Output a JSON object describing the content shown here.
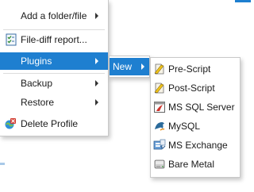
{
  "main_menu": {
    "items": [
      {
        "label": "Add a folder/file",
        "submenu": true
      },
      {
        "label": "File-diff report...",
        "submenu": false
      },
      {
        "label": "Plugins",
        "submenu": true
      },
      {
        "label": "Backup",
        "submenu": true
      },
      {
        "label": "Restore",
        "submenu": true
      },
      {
        "label": "Delete Profile",
        "submenu": false
      }
    ]
  },
  "plugins_menu": {
    "items": [
      {
        "label": "New",
        "submenu": true
      }
    ]
  },
  "new_menu": {
    "items": [
      {
        "label": "Pre-Script",
        "icon": "script-icon"
      },
      {
        "label": "Post-Script",
        "icon": "script-icon"
      },
      {
        "label": "MS SQL Server",
        "icon": "sql-server-icon"
      },
      {
        "label": "MySQL",
        "icon": "mysql-icon"
      },
      {
        "label": "MS Exchange",
        "icon": "exchange-icon"
      },
      {
        "label": "Bare Metal",
        "icon": "disk-icon"
      }
    ]
  },
  "colors": {
    "highlight": "#1e7fd0",
    "highlight_text": "#ffffff",
    "border": "#c9c9c9"
  }
}
